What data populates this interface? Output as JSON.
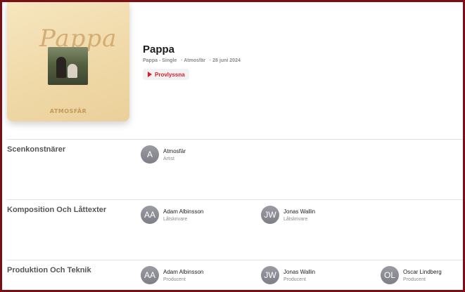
{
  "header": {
    "artwork": {
      "title_script": "Pappa",
      "brand": "ATMOSFÄR"
    },
    "title": "Pappa",
    "meta": [
      "Pappa - Single",
      "· Atmosfär",
      "· 28 juni 2024"
    ],
    "preview_label": "Provlyssna",
    "accent_color": "#d61f2b"
  },
  "sections": [
    {
      "title": "Scenkonstnärer",
      "people": [
        {
          "initials": "A",
          "name": "Atmosfär",
          "role": "Artist"
        }
      ]
    },
    {
      "title": "Komposition Och Låttexter",
      "people": [
        {
          "initials": "AA",
          "name": "Adam Albinsson",
          "role": "Låtskrivare"
        },
        {
          "initials": "JW",
          "name": "Jonas Wallin",
          "role": "Låtskrivare"
        }
      ]
    },
    {
      "title": "Produktion Och Teknik",
      "people": [
        {
          "initials": "AA",
          "name": "Adam Albinsson",
          "role": "Producent"
        },
        {
          "initials": "JW",
          "name": "Jonas Wallin",
          "role": "Producent"
        },
        {
          "initials": "OL",
          "name": "Oscar Lindberg",
          "role": "Producent"
        }
      ]
    }
  ]
}
